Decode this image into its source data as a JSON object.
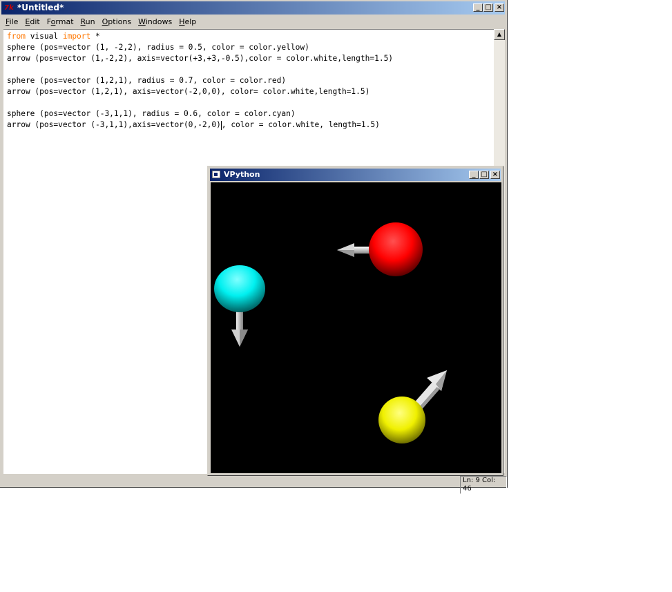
{
  "editor": {
    "title": "*Untitled*",
    "app_icon": "7k",
    "window_buttons": [
      "_",
      "□",
      "×"
    ],
    "menu": [
      "File",
      "Edit",
      "Format",
      "Run",
      "Options",
      "Windows",
      "Help"
    ],
    "menu_mnemonics": [
      "F",
      "E",
      "o",
      "R",
      "O",
      "W",
      "H"
    ],
    "code_lines": [
      [
        {
          "t": "from",
          "k": true
        },
        {
          "t": " visual "
        },
        {
          "t": "import",
          "k": true
        },
        {
          "t": " *"
        }
      ],
      [
        {
          "t": "sphere (pos=vector (1, -2,2), radius = 0.5, color = color.yellow)"
        }
      ],
      [
        {
          "t": "arrow (pos=vector (1,-2,2), axis=vector(+3,+3,-0.5),color = color.white,length=1.5)"
        }
      ],
      [
        {
          "t": ""
        }
      ],
      [
        {
          "t": "sphere (pos=vector (1,2,1), radius = 0.7, color = color.red)"
        }
      ],
      [
        {
          "t": "arrow (pos=vector (1,2,1), axis=vector(-2,0,0), color= color.white,length=1.5)"
        }
      ],
      [
        {
          "t": ""
        }
      ],
      [
        {
          "t": "sphere (pos=vector (-3,1,1), radius = 0.6, color = color.cyan)"
        }
      ],
      [
        {
          "t": "arrow (pos=vector (-3,1,1),axis=vector(0,-2,0)"
        },
        {
          "caret": true
        },
        {
          "t": ", color = color.white, length=1.5)"
        }
      ]
    ],
    "status": "Ln: 9 Col: 46",
    "keyword_color": "#ff7700"
  },
  "vpython": {
    "title": "VPython",
    "window_buttons": [
      "_",
      "□",
      "×"
    ],
    "background": "#000000",
    "spheres": [
      {
        "name": "yellow-sphere",
        "color": "#ffff00"
      },
      {
        "name": "red-sphere",
        "color": "#ff0000"
      },
      {
        "name": "cyan-sphere",
        "color": "#00ffff"
      }
    ],
    "arrows": [
      {
        "name": "arrow-yellow",
        "color": "#ffffff"
      },
      {
        "name": "arrow-red",
        "color": "#ffffff"
      },
      {
        "name": "arrow-cyan",
        "color": "#ffffff"
      }
    ]
  }
}
